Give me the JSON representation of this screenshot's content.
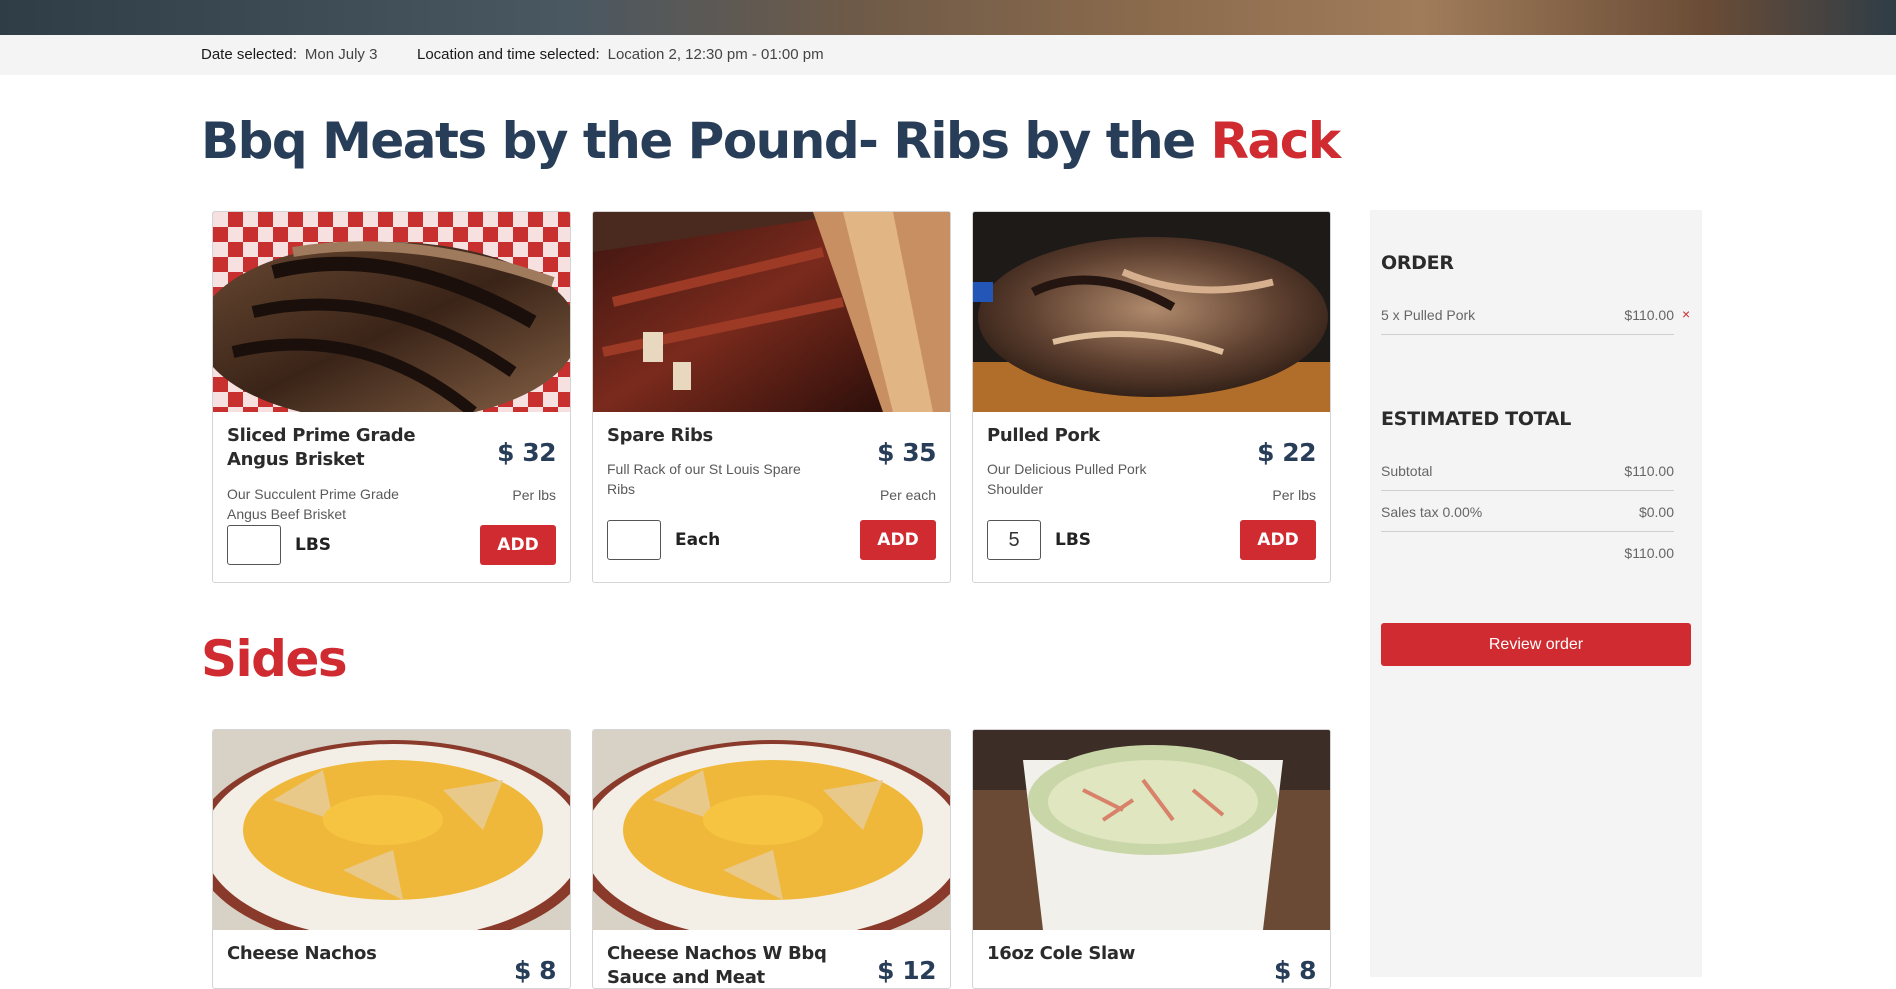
{
  "info": {
    "date_label": "Date selected:",
    "date_value": "Mon July 3",
    "location_label": "Location and time selected:",
    "location_value": "Location 2, 12:30 pm - 01:00 pm"
  },
  "meats_section": {
    "title": "Bbq Meats by the Pound- Ribs by the",
    "title_accent": "Rack",
    "items": [
      {
        "name": "Sliced Prime Grade Angus Brisket",
        "price": "$ 32",
        "description": "Our Succulent Prime Grade Angus Beef Brisket",
        "unit_note": "Per lbs",
        "quantity": "",
        "unit": "LBS",
        "add_label": "ADD",
        "image": "brisket-photo"
      },
      {
        "name": "Spare Ribs",
        "price": "$ 35",
        "description": "Full Rack of our St Louis Spare Ribs",
        "unit_note": "Per each",
        "quantity": "",
        "unit": "Each",
        "add_label": "ADD",
        "image": "spare-ribs-photo"
      },
      {
        "name": "Pulled Pork",
        "price": "$ 22",
        "description": "Our Delicious Pulled Pork Shoulder",
        "unit_note": "Per lbs",
        "quantity": "5",
        "unit": "LBS",
        "add_label": "ADD",
        "image": "pulled-pork-photo"
      }
    ]
  },
  "sides_section": {
    "title": "Sides",
    "items": [
      {
        "name": "Cheese Nachos",
        "price": "$ 8",
        "image": "cheese-nachos-photo"
      },
      {
        "name": "Cheese Nachos W Bbq Sauce and Meat",
        "price": "$ 12",
        "image": "cheese-nachos-bbq-photo"
      },
      {
        "name": "16oz Cole Slaw",
        "price": "$ 8",
        "image": "cole-slaw-photo"
      }
    ]
  },
  "order": {
    "title": "ORDER",
    "items": [
      {
        "label": "5 x Pulled Pork",
        "amount": "$110.00",
        "remove": "×"
      }
    ],
    "total_title": "ESTIMATED TOTAL",
    "subtotal_label": "Subtotal",
    "subtotal_value": "$110.00",
    "tax_label": "Sales tax 0.00%",
    "tax_value": "$0.00",
    "total_value": "$110.00",
    "review_label": "Review order"
  },
  "colors": {
    "navy": "#283e58",
    "red": "#cf2b30"
  }
}
